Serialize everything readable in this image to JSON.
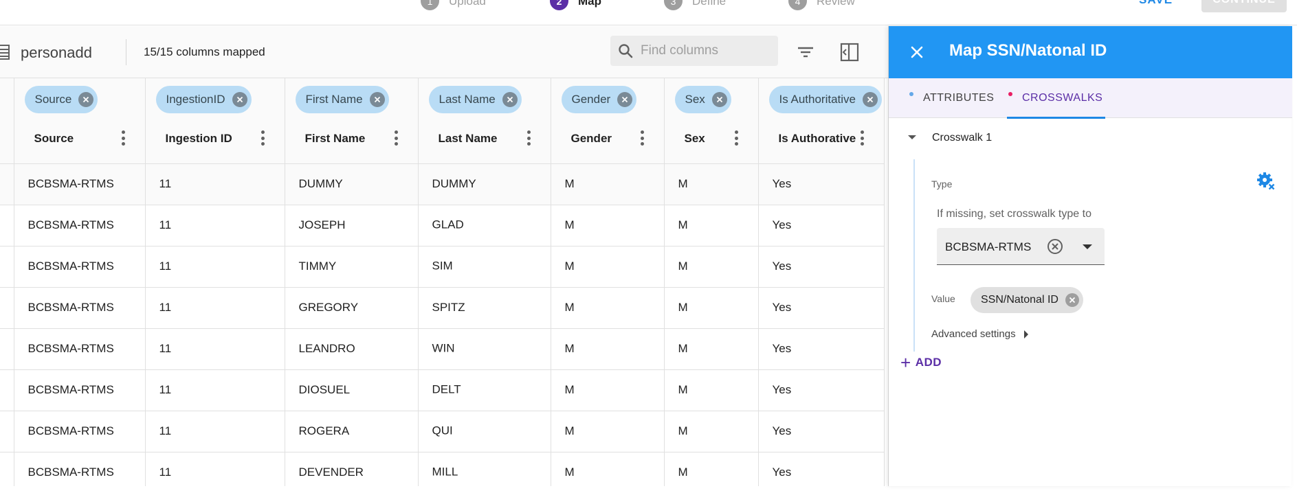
{
  "stepper": {
    "steps": [
      {
        "number": "1",
        "label": "Upload"
      },
      {
        "number": "2",
        "label": "Map"
      },
      {
        "number": "3",
        "label": "Define"
      },
      {
        "number": "4",
        "label": "Review"
      }
    ],
    "active_step": "Map",
    "save_label": "SAVE",
    "continue_label": "CONTINUE"
  },
  "toolbar": {
    "entity_name": "personadd",
    "mapped_status": "15/15 columns mapped",
    "search_placeholder": "Find columns",
    "icons": {
      "table": "table-list-icon",
      "filter": "filter-icon",
      "layout": "panel-layout-icon",
      "search": "search-icon"
    }
  },
  "table": {
    "columns": [
      {
        "chip": "Source",
        "title": "Source"
      },
      {
        "chip": "IngestionID",
        "title": "Ingestion ID"
      },
      {
        "chip": "First Name",
        "title": "First Name"
      },
      {
        "chip": "Last Name",
        "title": "Last Name"
      },
      {
        "chip": "Gender",
        "title": "Gender"
      },
      {
        "chip": "Sex",
        "title": "Sex"
      },
      {
        "chip": "Is Authoritative",
        "title": "Is Authorative"
      }
    ],
    "rows": [
      [
        "BCBSMA-RTMS",
        "11",
        "DUMMY",
        "DUMMY",
        "M",
        "M",
        "Yes"
      ],
      [
        "BCBSMA-RTMS",
        "11",
        "JOSEPH",
        "GLAD",
        "M",
        "M",
        "Yes"
      ],
      [
        "BCBSMA-RTMS",
        "11",
        "TIMMY",
        "SIM",
        "M",
        "M",
        "Yes"
      ],
      [
        "BCBSMA-RTMS",
        "11",
        "GREGORY",
        "SPITZ",
        "M",
        "M",
        "Yes"
      ],
      [
        "BCBSMA-RTMS",
        "11",
        "LEANDRO",
        "WIN",
        "M",
        "M",
        "Yes"
      ],
      [
        "BCBSMA-RTMS",
        "11",
        "DIOSUEL",
        "DELT",
        "M",
        "M",
        "Yes"
      ],
      [
        "BCBSMA-RTMS",
        "11",
        "ROGERA",
        "QUI",
        "M",
        "M",
        "Yes"
      ],
      [
        "BCBSMA-RTMS",
        "11",
        "DEVENDER",
        "MILL",
        "M",
        "M",
        "Yes"
      ]
    ],
    "redacted_last_names": [
      false,
      true,
      true,
      false,
      true,
      true,
      true,
      true
    ]
  },
  "panel": {
    "title": "Map SSN/Natonal ID",
    "tabs": [
      "ATTRIBUTES",
      "CROSSWALKS"
    ],
    "active_tab": "CROSSWALKS",
    "crosswalk": {
      "title": "Crosswalk 1",
      "type_label": "Type",
      "missing_label": "If missing, set crosswalk type to",
      "selected_type": "BCBSMA-RTMS",
      "value_label": "Value",
      "value_chip": "SSN/Natonal ID",
      "advanced_label": "Advanced settings"
    },
    "add_label": "ADD"
  },
  "colors": {
    "panel_header": "#2196f3",
    "accent_purple": "#5b2ea6",
    "chip_blue": "#b9dcf5",
    "tab_bg": "#f4f1fb"
  }
}
